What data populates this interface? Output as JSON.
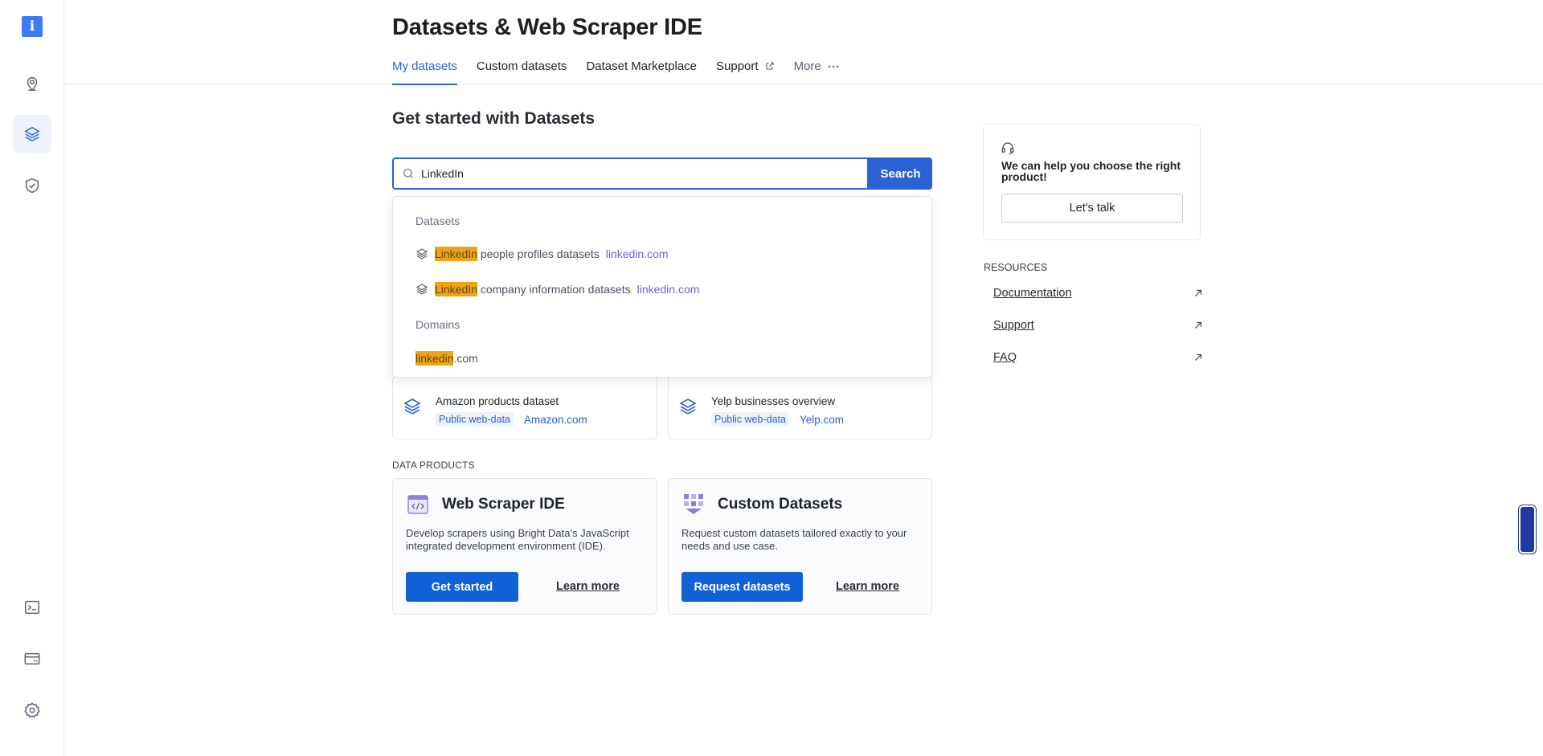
{
  "header": {
    "title": "Datasets & Web Scraper IDE",
    "tabs": [
      {
        "label": "My datasets"
      },
      {
        "label": "Custom datasets"
      },
      {
        "label": "Dataset Marketplace"
      },
      {
        "label": "Support"
      },
      {
        "label": "More"
      }
    ]
  },
  "main": {
    "heading": "Get started with Datasets",
    "search": {
      "value": "LinkedIn",
      "button_label": "Search"
    },
    "dropdown": {
      "datasets_label": "Datasets",
      "items": [
        {
          "highlight": "LinkedIn",
          "rest": " people profiles datasets",
          "domain": "linkedin.com"
        },
        {
          "highlight": "LinkedIn",
          "rest": " company information datasets",
          "domain": "linkedin.com"
        }
      ],
      "domains_label": "Domains",
      "domain_item": {
        "highlight": "linkedin",
        "rest": ".com"
      }
    },
    "dataset_cards": [
      {
        "name": "Amazon products dataset",
        "tag": "Public web-data",
        "site": "Amazon.com"
      },
      {
        "name": "Yelp businesses overview",
        "tag": "Public web-data",
        "site": "Yelp.com"
      }
    ],
    "data_products_label": "DATA PRODUCTS",
    "products": [
      {
        "title": "Web Scraper IDE",
        "description": "Develop scrapers using Bright Data's JavaScript integrated development environment (IDE).",
        "primary": "Get started",
        "secondary": "Learn more"
      },
      {
        "title": "Custom Datasets",
        "description": "Request custom datasets tailored exactly to your needs and use case.",
        "primary": "Request datasets",
        "secondary": "Learn more"
      }
    ]
  },
  "aside": {
    "help_text": "We can help you choose the right product!",
    "talk_button": "Let's talk",
    "resources_label": "RESOURCES",
    "resources": [
      {
        "label": "Documentation"
      },
      {
        "label": "Support"
      },
      {
        "label": "FAQ"
      }
    ]
  },
  "sidebar": {
    "items": [
      {
        "icon": "info-icon"
      },
      {
        "icon": "location-pin-icon"
      },
      {
        "icon": "layers-icon"
      },
      {
        "icon": "shield-check-icon"
      },
      {
        "icon": "terminal-icon"
      },
      {
        "icon": "credit-card-icon"
      },
      {
        "icon": "gear-icon"
      }
    ]
  },
  "colors": {
    "accent": "#2a62d6",
    "primary_button": "#1060d8",
    "highlight": "#f2a314",
    "domain_link": "#6a63d8"
  }
}
